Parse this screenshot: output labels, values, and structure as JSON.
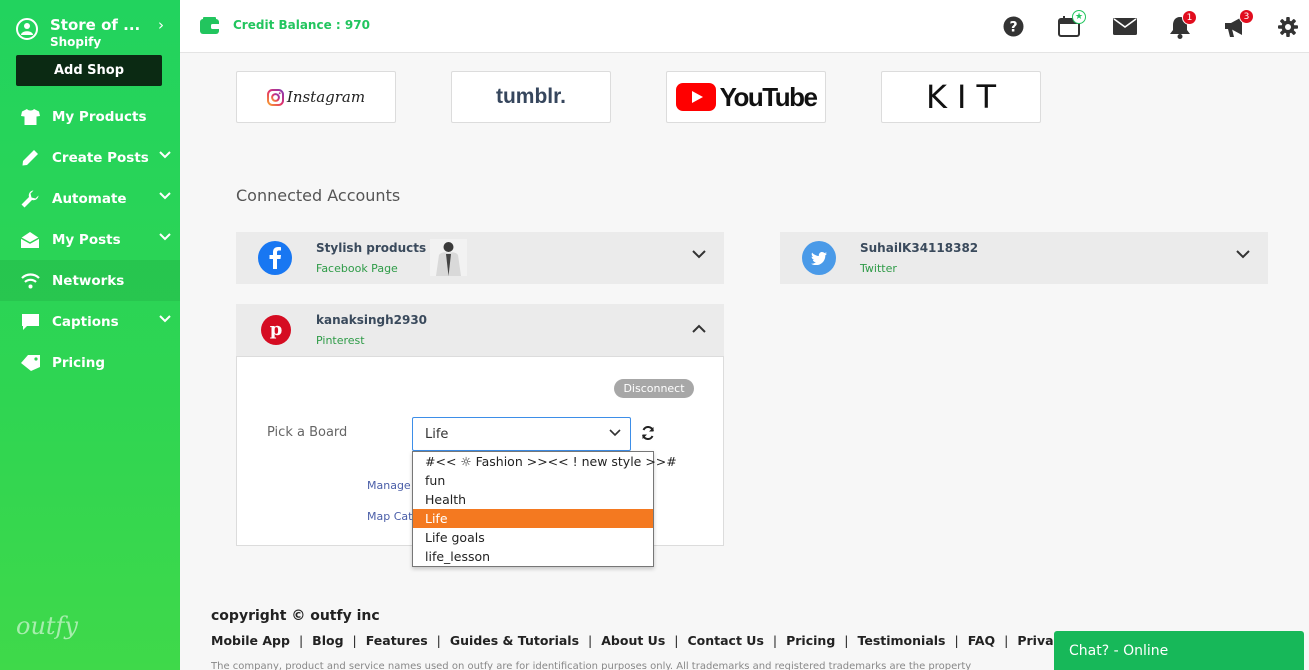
{
  "sidebar": {
    "store_name": "Store of ...",
    "store_platform": "Shopify",
    "add_shop": "Add Shop",
    "items": [
      {
        "label": "My Products",
        "icon": "shirt-icon"
      },
      {
        "label": "Create Posts",
        "icon": "pencil-icon"
      },
      {
        "label": "Automate",
        "icon": "wrench-icon"
      },
      {
        "label": "My Posts",
        "icon": "mail-open-icon"
      },
      {
        "label": "Networks",
        "icon": "wifi-icon"
      },
      {
        "label": "Captions",
        "icon": "comment-icon"
      },
      {
        "label": "Pricing",
        "icon": "tag-icon"
      }
    ],
    "brand": "outfy"
  },
  "topbar": {
    "credit": "Credit Balance : 970",
    "notifications_count": "1",
    "announcements_count": "3"
  },
  "networks": {
    "instagram": "Instagram",
    "tumblr": "tumblr.",
    "youtube": "YouTube",
    "kit": "KIT"
  },
  "connected": {
    "title": "Connected Accounts",
    "accounts": [
      {
        "name": "Stylish products",
        "type": "Facebook Page"
      },
      {
        "name": "SuhailK34118382",
        "type": "Twitter"
      },
      {
        "name": "kanaksingh2930",
        "type": "Pinterest"
      }
    ],
    "disconnect": "Disconnect",
    "pick_board_label": "Pick a Board",
    "selected_board": "Life",
    "manage_link": "Manage",
    "map_link": "Map Cat",
    "board_options": [
      "#<< ☼ Fashion >><< ! new style >>#",
      "fun",
      "Health",
      "Life",
      "Life goals",
      "life_lesson"
    ]
  },
  "footer": {
    "copyright": "copyright © outfy inc",
    "links": [
      "Mobile App",
      "Blog",
      "Features",
      "Guides & Tutorials",
      "About Us",
      "Contact Us",
      "Pricing",
      "Testimonials",
      "FAQ",
      "Privacy"
    ],
    "separator": "|",
    "disclaimer": "The company, product and service names used on outfy are for identification purposes only. All trademarks and registered trademarks are the property"
  },
  "chat": {
    "label": "Chat? - Online"
  },
  "colors": {
    "accent": "#22d35e",
    "selected_option": "#f47920",
    "facebook": "#1877f2",
    "twitter": "#4a9ae8",
    "pinterest": "#e60023",
    "youtube": "#ff0000"
  }
}
